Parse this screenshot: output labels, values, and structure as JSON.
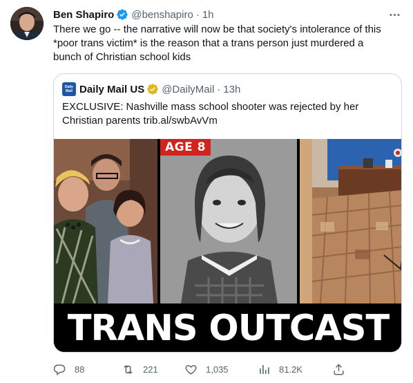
{
  "tweet": {
    "display_name": "Ben Shapiro",
    "handle": "@benshapiro",
    "separator": "·",
    "time": "1h",
    "lines": [
      "There we go -- the narrative will now be that society's intolerance of this",
      "*poor trans victim* is the reason that a trans person just murdered a",
      "bunch of Christian school kids"
    ]
  },
  "quote": {
    "avatar_line1": "Daily",
    "avatar_line2": "Mail",
    "display_name": "Daily Mail US",
    "handle": "@DailyMail",
    "separator": "·",
    "time": "13h",
    "lines": [
      "EXCLUSIVE: Nashville mass school shooter was rejected by her",
      "Christian parents trib.al/swbAvVm"
    ],
    "media": {
      "age_badge": "AGE 8",
      "headline": "TRANS OUTCAST"
    }
  },
  "actions": {
    "replies": "88",
    "retweets": "221",
    "likes": "1,035",
    "views": "81.2K"
  },
  "icons": {
    "verified": "verified-badge-icon",
    "more": "more-icon",
    "reply": "reply-icon",
    "retweet": "retweet-icon",
    "like": "heart-icon",
    "views": "views-icon",
    "share": "share-icon"
  },
  "colors": {
    "text": "#0f1419",
    "secondary": "#536471",
    "verified_blue": "#1d9bf0",
    "verified_gold": "#e2b719",
    "border": "#cfd9de",
    "badge_red": "#d0241c"
  }
}
